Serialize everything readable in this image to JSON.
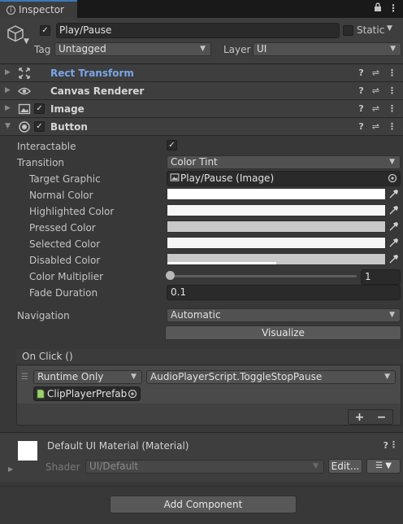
{
  "tab": {
    "title": "Inspector",
    "icon": "info-icon"
  },
  "header": {
    "enabled": "✓",
    "name": "Play/Pause",
    "static_label": "Static",
    "tag_label": "Tag",
    "tag_value": "Untagged",
    "layer_label": "Layer",
    "layer_value": "UI"
  },
  "components": [
    {
      "title": "Rect Transform",
      "icon": "rect-transform-icon"
    },
    {
      "title": "Canvas Renderer",
      "icon": "eye-icon"
    },
    {
      "title": "Image",
      "icon": "image-icon"
    },
    {
      "title": "Button",
      "icon": "button-icon"
    }
  ],
  "button_props": {
    "interactable_label": "Interactable",
    "interactable_value": "✓",
    "transition_label": "Transition",
    "transition_value": "Color Tint",
    "target_graphic_label": "Target Graphic",
    "target_graphic_value": "Play/Pause (Image)",
    "normal_color_label": "Normal Color",
    "highlighted_color_label": "Highlighted Color",
    "pressed_color_label": "Pressed Color",
    "selected_color_label": "Selected Color",
    "disabled_color_label": "Disabled Color",
    "color_multiplier_label": "Color Multiplier",
    "color_multiplier_value": "1",
    "fade_duration_label": "Fade Duration",
    "fade_duration_value": "0.1",
    "navigation_label": "Navigation",
    "navigation_value": "Automatic",
    "visualize_label": "Visualize"
  },
  "colors": {
    "normal": "#ffffff",
    "highlighted": "#f5f5f5",
    "pressed": "#c8c8c8",
    "selected": "#f5f5f5",
    "disabled": "#c8c8c8"
  },
  "on_click": {
    "title": "On Click ()",
    "runtime_value": "Runtime Only",
    "function_value": "AudioPlayerScript.ToggleStopPause",
    "object_value": "ClipPlayerPrefab",
    "plus": "+",
    "minus": "−"
  },
  "material": {
    "title": "Default UI Material (Material)",
    "shader_label": "Shader",
    "shader_value": "UI/Default",
    "edit_label": "Edit..."
  },
  "add_component_label": "Add Component"
}
